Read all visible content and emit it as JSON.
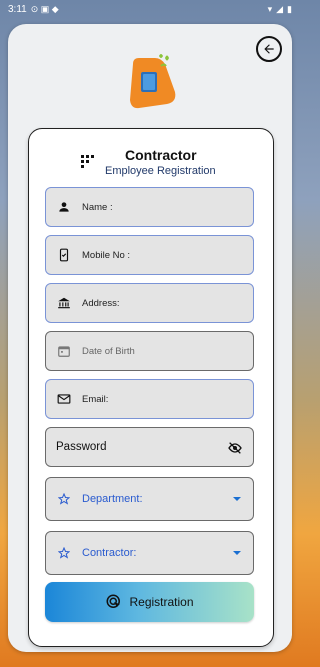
{
  "status_bar": {
    "time": "3:11"
  },
  "header": {
    "title": "Contractor",
    "subtitle": "Employee Registration"
  },
  "fields": {
    "name": "Name :",
    "mobile": "Mobile No :",
    "address": "Address:",
    "dob": "Date of Birth",
    "email": "Email:",
    "password": "Password"
  },
  "selects": {
    "department": "Department:",
    "contractor": "Contractor:"
  },
  "button": {
    "register": "Registration"
  },
  "colors": {
    "accent_blue": "#2a5bcf",
    "field_border": "#7a93d6",
    "logo_orange": "#f08a24"
  },
  "icons": [
    "back-arrow-icon",
    "grid-icon",
    "person-icon",
    "phone-icon",
    "bank-icon",
    "calendar-icon",
    "mail-icon",
    "eye-off-icon",
    "star-icon",
    "caret-down-icon",
    "click-icon"
  ]
}
